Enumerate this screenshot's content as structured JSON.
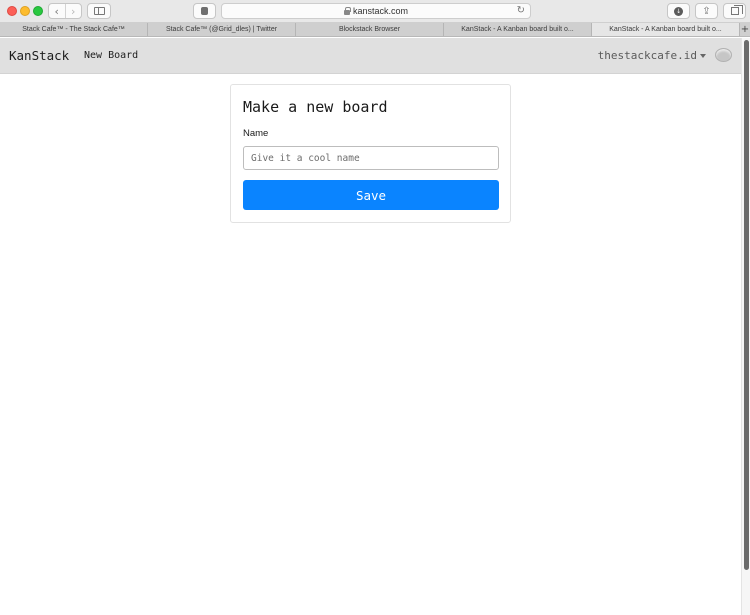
{
  "browser": {
    "url": "kanstack.com",
    "tabs": [
      {
        "title": "Stack Cafe™ - The Stack Cafe™",
        "active": false
      },
      {
        "title": "Stack Cafe™ (@Grid_dles) | Twitter",
        "active": false
      },
      {
        "title": "Blockstack Browser",
        "active": false
      },
      {
        "title": "KanStack - A Kanban board built o...",
        "active": false
      },
      {
        "title": "KanStack - A Kanban board built o...",
        "active": true
      }
    ],
    "icons": {
      "back": "chevron-left-icon",
      "forward": "chevron-right-icon",
      "sidebar": "sidebar-icon",
      "privacy": "privacy-icon",
      "lock": "lock-icon",
      "reload": "reload-icon",
      "downloads": "download-icon",
      "share": "share-icon",
      "tabs": "tabs-icon",
      "new_tab": "plus-icon"
    }
  },
  "app": {
    "brand": "KanStack",
    "nav": {
      "new_board": "New Board"
    },
    "user": {
      "name": "thestackcafe.id"
    }
  },
  "form": {
    "title": "Make a new board",
    "name_label": "Name",
    "name_value": "",
    "name_placeholder": "Give it a cool name",
    "save_label": "Save"
  },
  "colors": {
    "accent": "#0a84ff",
    "header_bg": "#e0e0e0",
    "page_bg": "#ffffff"
  }
}
